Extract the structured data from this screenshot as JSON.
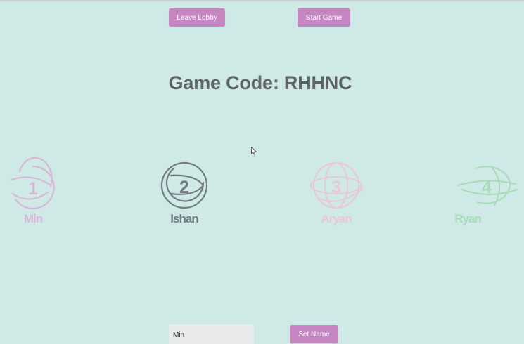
{
  "lobby": {
    "leave_label": "Leave Lobby",
    "start_label": "Start Game",
    "game_code_text": "Game Code: RHHNC"
  },
  "players": [
    {
      "number": "1",
      "name": "Min",
      "color": "#d8b8d8",
      "icon": "orbit-circle-icon"
    },
    {
      "number": "2",
      "name": "Ishan",
      "color": "#737c80",
      "icon": "orbit-circle-icon"
    },
    {
      "number": "3",
      "name": "Aryan",
      "color": "#e8c7d8",
      "icon": "orbit-circle-icon"
    },
    {
      "number": "4",
      "name": "Ryan",
      "color": "#a8dcb9",
      "icon": "orbit-circle-icon"
    }
  ],
  "name_form": {
    "input_value": "Min",
    "set_name_label": "Set Name"
  },
  "colors": {
    "background": "#cfe9e7",
    "button": "#c586c2",
    "title": "#5e6466"
  }
}
